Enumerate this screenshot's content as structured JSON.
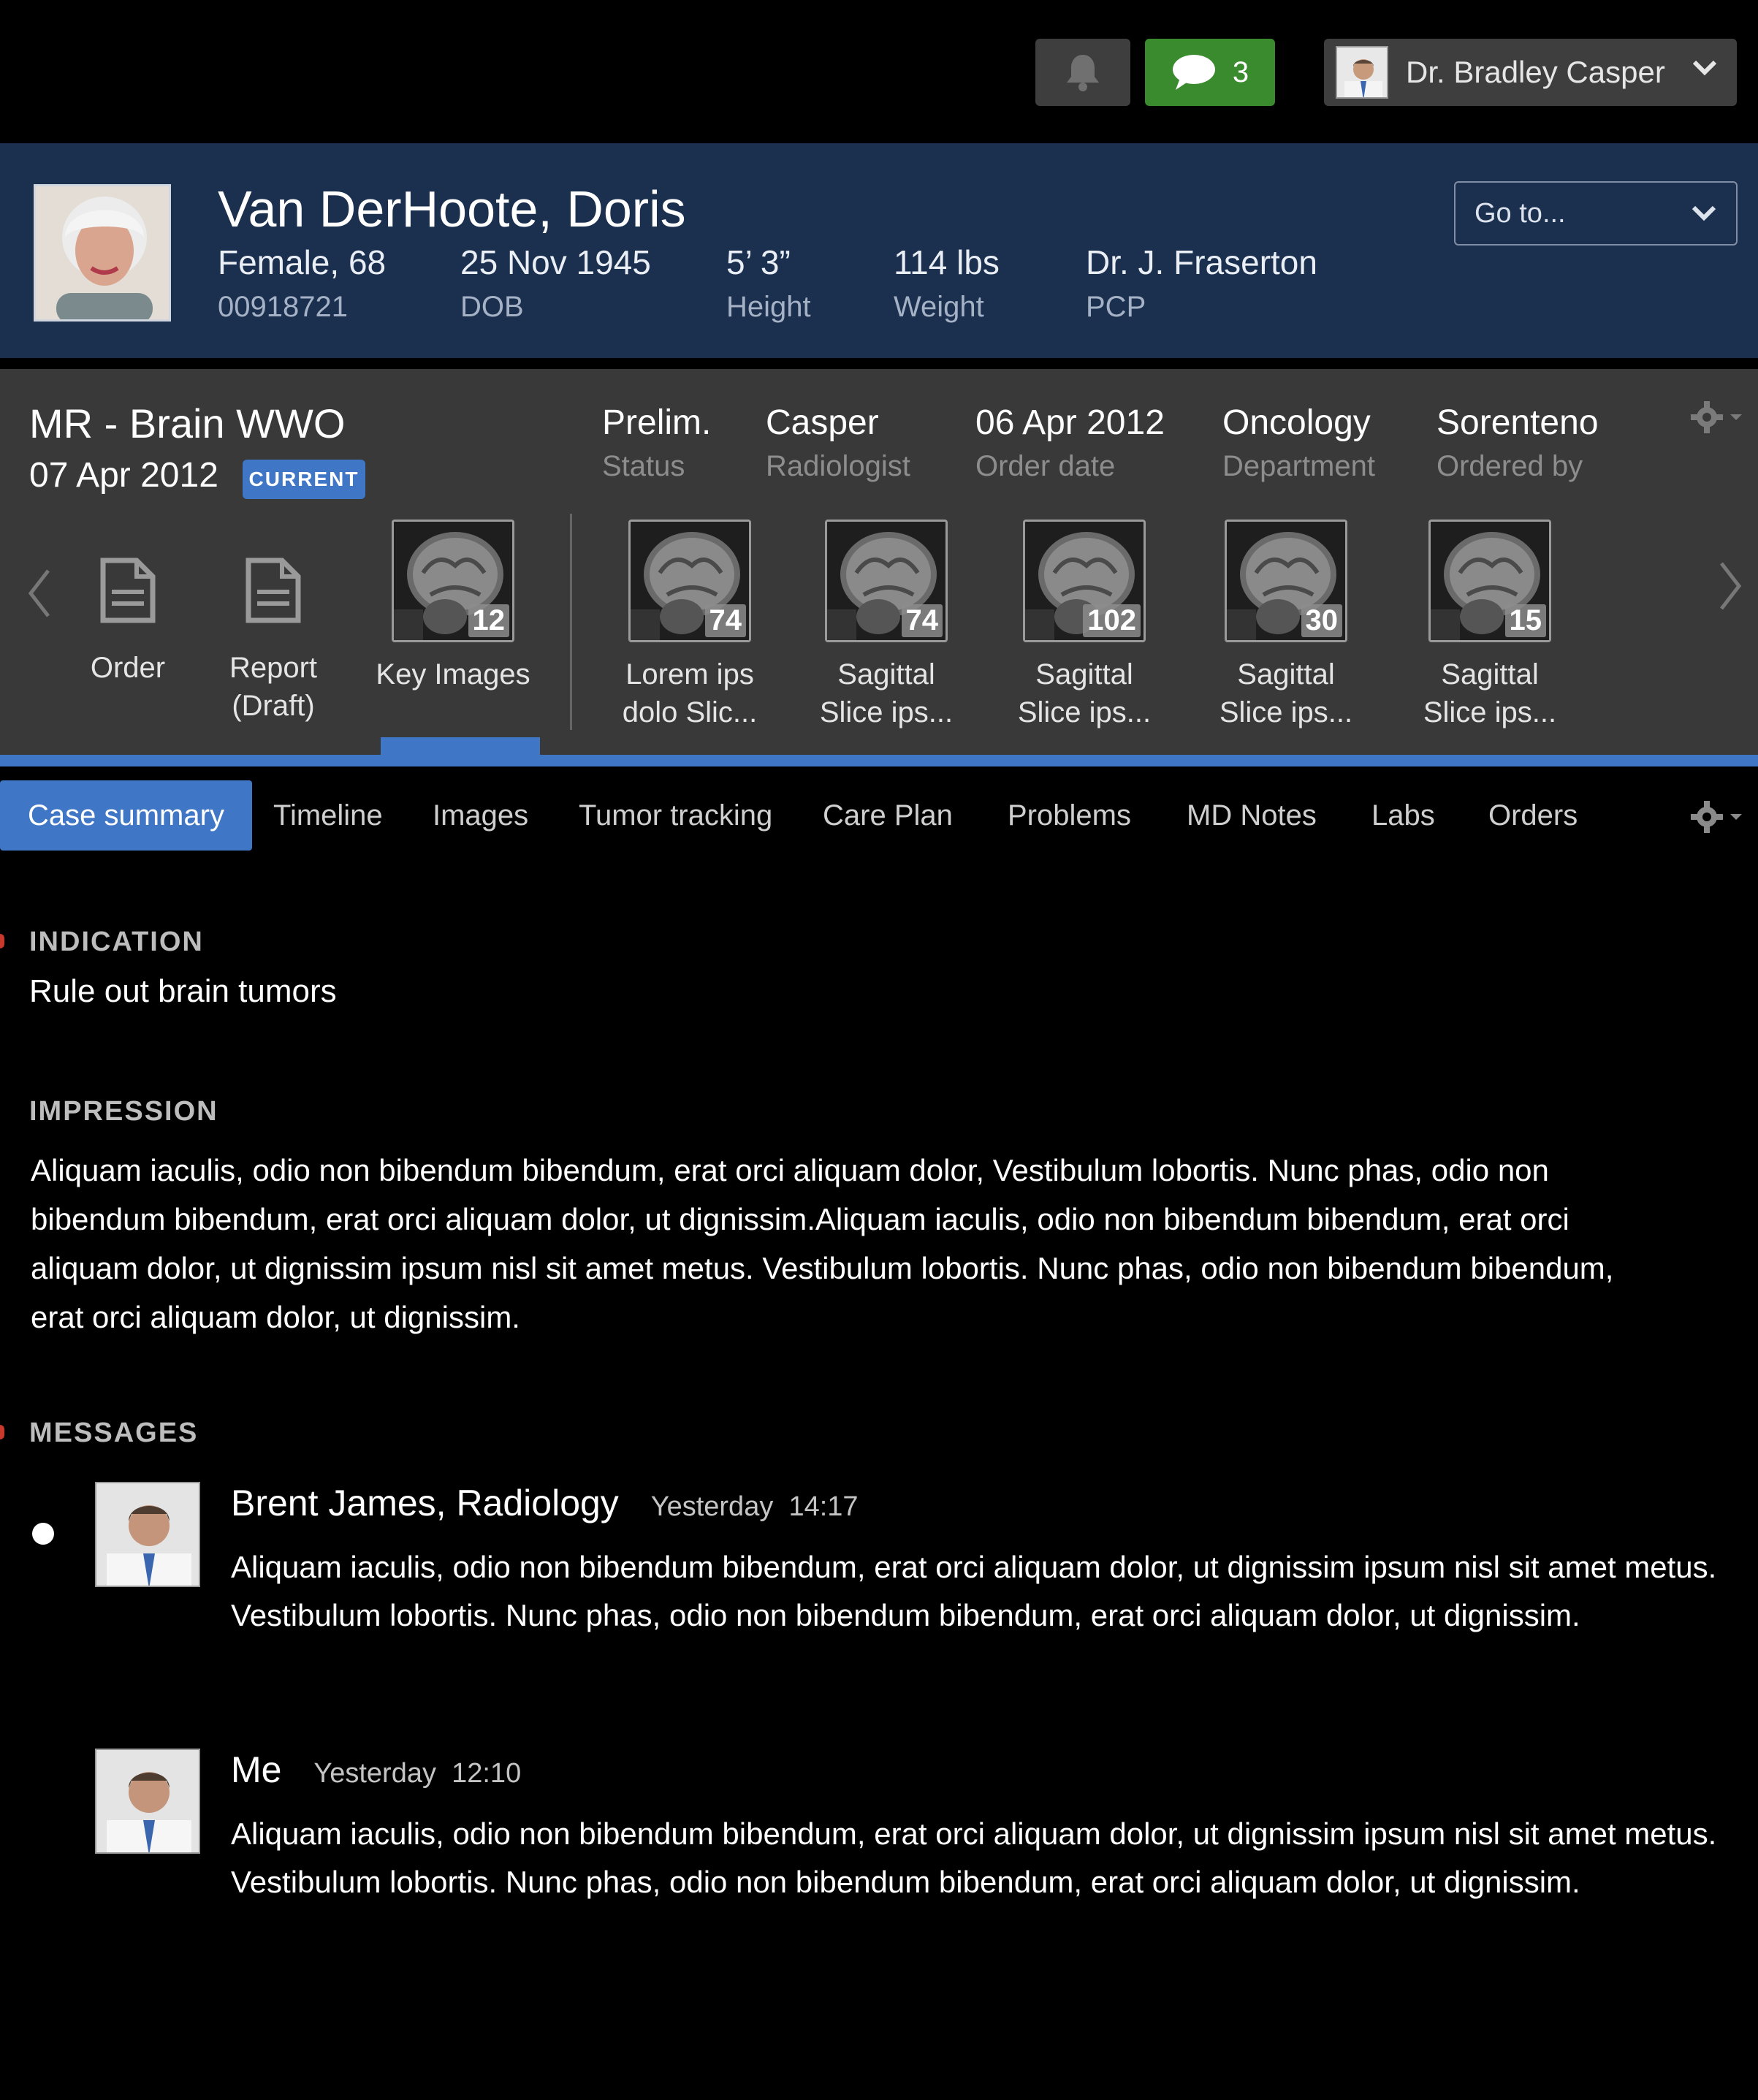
{
  "topbar": {
    "message_count": "3",
    "user_name": "Dr. Bradley Casper"
  },
  "patient": {
    "name": "Van DerHoote, Doris",
    "sex_age": "Female, 68",
    "mrn": "00918721",
    "dob": "25 Nov 1945",
    "dob_label": "DOB",
    "height": "5’ 3”",
    "height_label": "Height",
    "weight": "114 lbs",
    "weight_label": "Weight",
    "pcp": "Dr. J. Fraserton",
    "pcp_label": "PCP",
    "goto_label": "Go to..."
  },
  "exam": {
    "title": "MR - Brain WWO",
    "date": "07 Apr 2012",
    "badge": "CURRENT",
    "fields": [
      {
        "value": "Prelim.",
        "label": "Status"
      },
      {
        "value": "Casper",
        "label": "Radiologist"
      },
      {
        "value": "06 Apr 2012",
        "label": "Order date"
      },
      {
        "value": "Oncology",
        "label": "Department"
      },
      {
        "value": "Sorenteno",
        "label": "Ordered by"
      }
    ],
    "docs": [
      {
        "line1": "Order",
        "line2": ""
      },
      {
        "line1": "Report",
        "line2": "(Draft)"
      }
    ],
    "key_images": {
      "count": "12",
      "label": "Key Images"
    },
    "series": [
      {
        "count": "74",
        "line1": "Lorem ips",
        "line2": "dolo Slic..."
      },
      {
        "count": "74",
        "line1": "Sagittal",
        "line2": "Slice ips..."
      },
      {
        "count": "102",
        "line1": "Sagittal",
        "line2": "Slice ips..."
      },
      {
        "count": "30",
        "line1": "Sagittal",
        "line2": "Slice ips..."
      },
      {
        "count": "15",
        "line1": "Sagittal",
        "line2": "Slice ips..."
      }
    ]
  },
  "tabs": [
    "Case summary",
    "Timeline",
    "Images",
    "Tumor tracking",
    "Care Plan",
    "Problems",
    "MD Notes",
    "Labs",
    "Orders"
  ],
  "content": {
    "indication_head": "INDICATION",
    "indication": "Rule out brain tumors",
    "impression_head": "IMPRESSION",
    "impression": "Aliquam iaculis, odio non bibendum bibendum, erat orci aliquam dolor, Vestibulum lobortis. Nunc phas, odio non bibendum bibendum, erat orci aliquam dolor, ut dignissim.Aliquam iaculis, odio non bibendum bibendum, erat orci aliquam dolor, ut dignissim ipsum nisl sit amet metus. Vestibulum lobortis. Nunc phas, odio non bibendum bibendum, erat orci aliquam dolor, ut dignissim.",
    "messages_head": "MESSAGES",
    "messages": [
      {
        "author": "Brent James, Radiology",
        "day": "Yesterday",
        "time": "14:17",
        "text": "Aliquam iaculis, odio non bibendum bibendum, erat orci aliquam dolor, ut dignissim ipsum nisl sit amet metus. Vestibulum lobortis. Nunc phas, odio non bibendum bibendum, erat orci aliquam dolor, ut dignissim."
      },
      {
        "author": "Me",
        "day": "Yesterday",
        "time": "12:10",
        "text": "Aliquam iaculis, odio non bibendum bibendum, erat orci aliquam dolor, ut dignissim ipsum nisl sit amet metus. Vestibulum lobortis. Nunc phas, odio non bibendum bibendum, erat orci aliquam dolor, ut dignissim."
      }
    ]
  },
  "colors": {
    "header_blue": "#1b2f4f",
    "accent_blue": "#3f76c6",
    "exam_gray": "#393939",
    "message_green": "#3a8a2e"
  }
}
